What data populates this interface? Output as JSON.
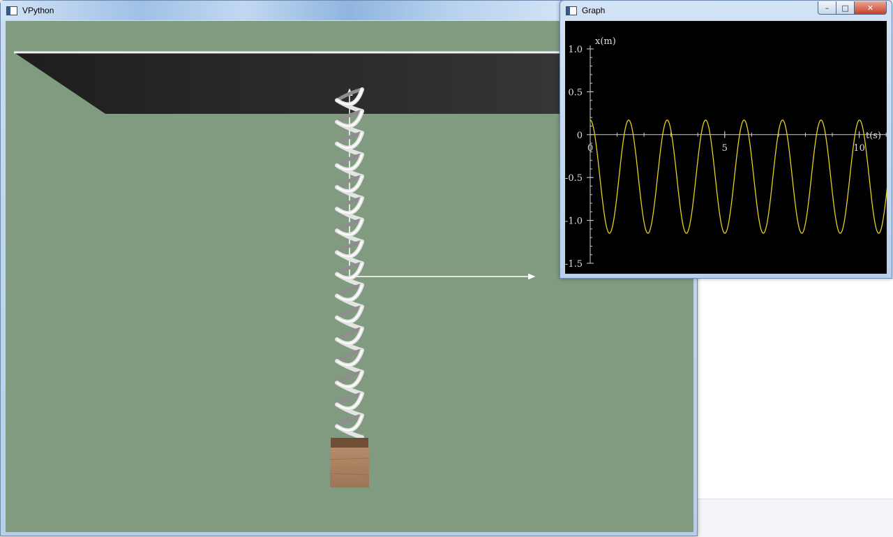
{
  "vpython_window": {
    "title": "VPython"
  },
  "graph_window": {
    "title": "Graph",
    "controls": {
      "minimize": "–",
      "maximize": "□",
      "close": "✕"
    }
  },
  "scene": {
    "background_color": "#819b81",
    "ceiling_color": "#2b2b2b",
    "spring_color": "#d8d8d8",
    "block_color": "#a9805e",
    "arrow_color": "#ffffff"
  },
  "chart_data": {
    "type": "line",
    "xlabel": "t(s)",
    "ylabel": "x(m)",
    "xlim": [
      0,
      11.1
    ],
    "ylim": [
      -1.5,
      1.0
    ],
    "x_ticks": [
      {
        "value": 0,
        "label": "0"
      },
      {
        "value": 5,
        "label": "5"
      },
      {
        "value": 10,
        "label": "10"
      }
    ],
    "y_ticks": [
      {
        "value": 1.0,
        "label": "1.0"
      },
      {
        "value": 0.5,
        "label": "0.5"
      },
      {
        "value": 0,
        "label": "0"
      },
      {
        "value": -0.5,
        "label": "-0.5"
      },
      {
        "value": -1.0,
        "label": "-1.0"
      },
      {
        "value": -1.5,
        "label": "-1.5"
      }
    ],
    "series": [
      {
        "color": "#e6d21e",
        "description_form": "x = c + A cos(2π t / T)",
        "amplitude": 0.66,
        "center": -0.49,
        "period": 1.43,
        "t_start": 0,
        "t_end": 11.1,
        "x": [
          0,
          0.36,
          0.72,
          1.07,
          1.43,
          2.15,
          2.86,
          3.58,
          4.29,
          5.0,
          5.72,
          6.43,
          7.15,
          7.86,
          8.58,
          9.29,
          10.0,
          10.72,
          11.1
        ],
        "y": [
          0.17,
          -0.49,
          -1.15,
          -0.49,
          0.17,
          -1.15,
          0.17,
          -1.15,
          0.17,
          -1.15,
          0.17,
          -1.15,
          0.17,
          -1.15,
          0.17,
          -1.15,
          0.17,
          -1.15,
          -0.72
        ]
      }
    ],
    "grid": false,
    "background": "#000000",
    "axis_color": "#cfcfcf"
  }
}
